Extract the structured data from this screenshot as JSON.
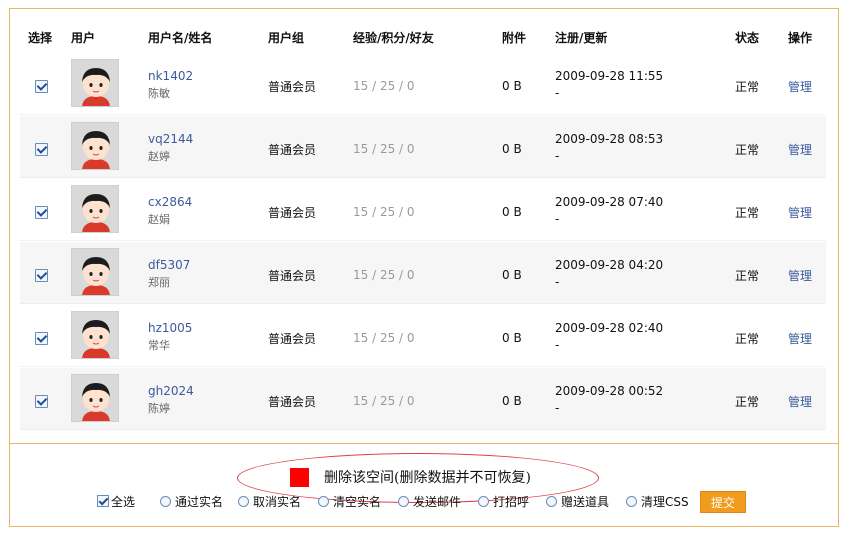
{
  "table": {
    "headers": {
      "select": "选择",
      "user": "用户",
      "username_realname": "用户名/姓名",
      "group": "用户组",
      "stats": "经验/积分/好友",
      "attachments": "附件",
      "register_update": "注册/更新",
      "status": "状态",
      "actions": "操作"
    },
    "rows": [
      {
        "username": "nk1402",
        "realname": "陈敏",
        "group": "普通会员",
        "stats": "15 / 25 / 0",
        "attachments": "0 B",
        "registered": "2009-09-28 11:55",
        "updated": "-",
        "status": "正常",
        "action": "管理",
        "checked": true
      },
      {
        "username": "vq2144",
        "realname": "赵婷",
        "group": "普通会员",
        "stats": "15 / 25 / 0",
        "attachments": "0 B",
        "registered": "2009-09-28 08:53",
        "updated": "-",
        "status": "正常",
        "action": "管理",
        "checked": true
      },
      {
        "username": "cx2864",
        "realname": "赵娟",
        "group": "普通会员",
        "stats": "15 / 25 / 0",
        "attachments": "0 B",
        "registered": "2009-09-28 07:40",
        "updated": "-",
        "status": "正常",
        "action": "管理",
        "checked": true
      },
      {
        "username": "df5307",
        "realname": "郑丽",
        "group": "普通会员",
        "stats": "15 / 25 / 0",
        "attachments": "0 B",
        "registered": "2009-09-28 04:20",
        "updated": "-",
        "status": "正常",
        "action": "管理",
        "checked": true
      },
      {
        "username": "hz1005",
        "realname": "常华",
        "group": "普通会员",
        "stats": "15 / 25 / 0",
        "attachments": "0 B",
        "registered": "2009-09-28 02:40",
        "updated": "-",
        "status": "正常",
        "action": "管理",
        "checked": true
      },
      {
        "username": "gh2024",
        "realname": "陈婷",
        "group": "普通会员",
        "stats": "15 / 25 / 0",
        "attachments": "0 B",
        "registered": "2009-09-28 00:52",
        "updated": "-",
        "status": "正常",
        "action": "管理",
        "checked": true
      }
    ]
  },
  "delete_option": {
    "label": "删除该空间(删除数据并不可恢复)",
    "color": "#ff0000"
  },
  "bulk_actions": {
    "select_all": "全选",
    "options": [
      "通过实名",
      "取消实名",
      "清空实名",
      "发送邮件",
      "打招呼",
      "赠送道具",
      "清理CSS"
    ],
    "submit": "提交"
  },
  "colors": {
    "border": "#e8b566",
    "link": "#3b5a9b",
    "submit_bg": "#f29c1f",
    "oval": "#e0404a"
  }
}
